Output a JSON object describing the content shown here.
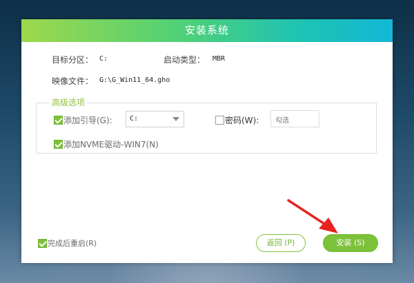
{
  "window": {
    "title": "安装系统"
  },
  "info": {
    "target_partition_label": "目标分区：",
    "target_partition_value": "C:",
    "boot_type_label": "启动类型：",
    "boot_type_value": "MBR",
    "image_file_label": "映像文件：",
    "image_file_value": "G:\\G_Win11_64.gho"
  },
  "advanced": {
    "legend": "高级选项",
    "add_boot_label": "添加引导(G):",
    "add_boot_checked": true,
    "boot_drive_selected": "C:",
    "password_label": "密码(W):",
    "password_checked": false,
    "password_placeholder": "勾选",
    "nvme_label": "添加NVME驱动-WIN7(N)",
    "nvme_checked": true
  },
  "footer": {
    "restart_label": "完成后重启(R)",
    "restart_checked": true,
    "back_label": "返回 (P)",
    "install_label": "安装 (S)"
  },
  "colors": {
    "accent_green": "#7cc13a",
    "annotation_arrow": "#e8231f"
  }
}
